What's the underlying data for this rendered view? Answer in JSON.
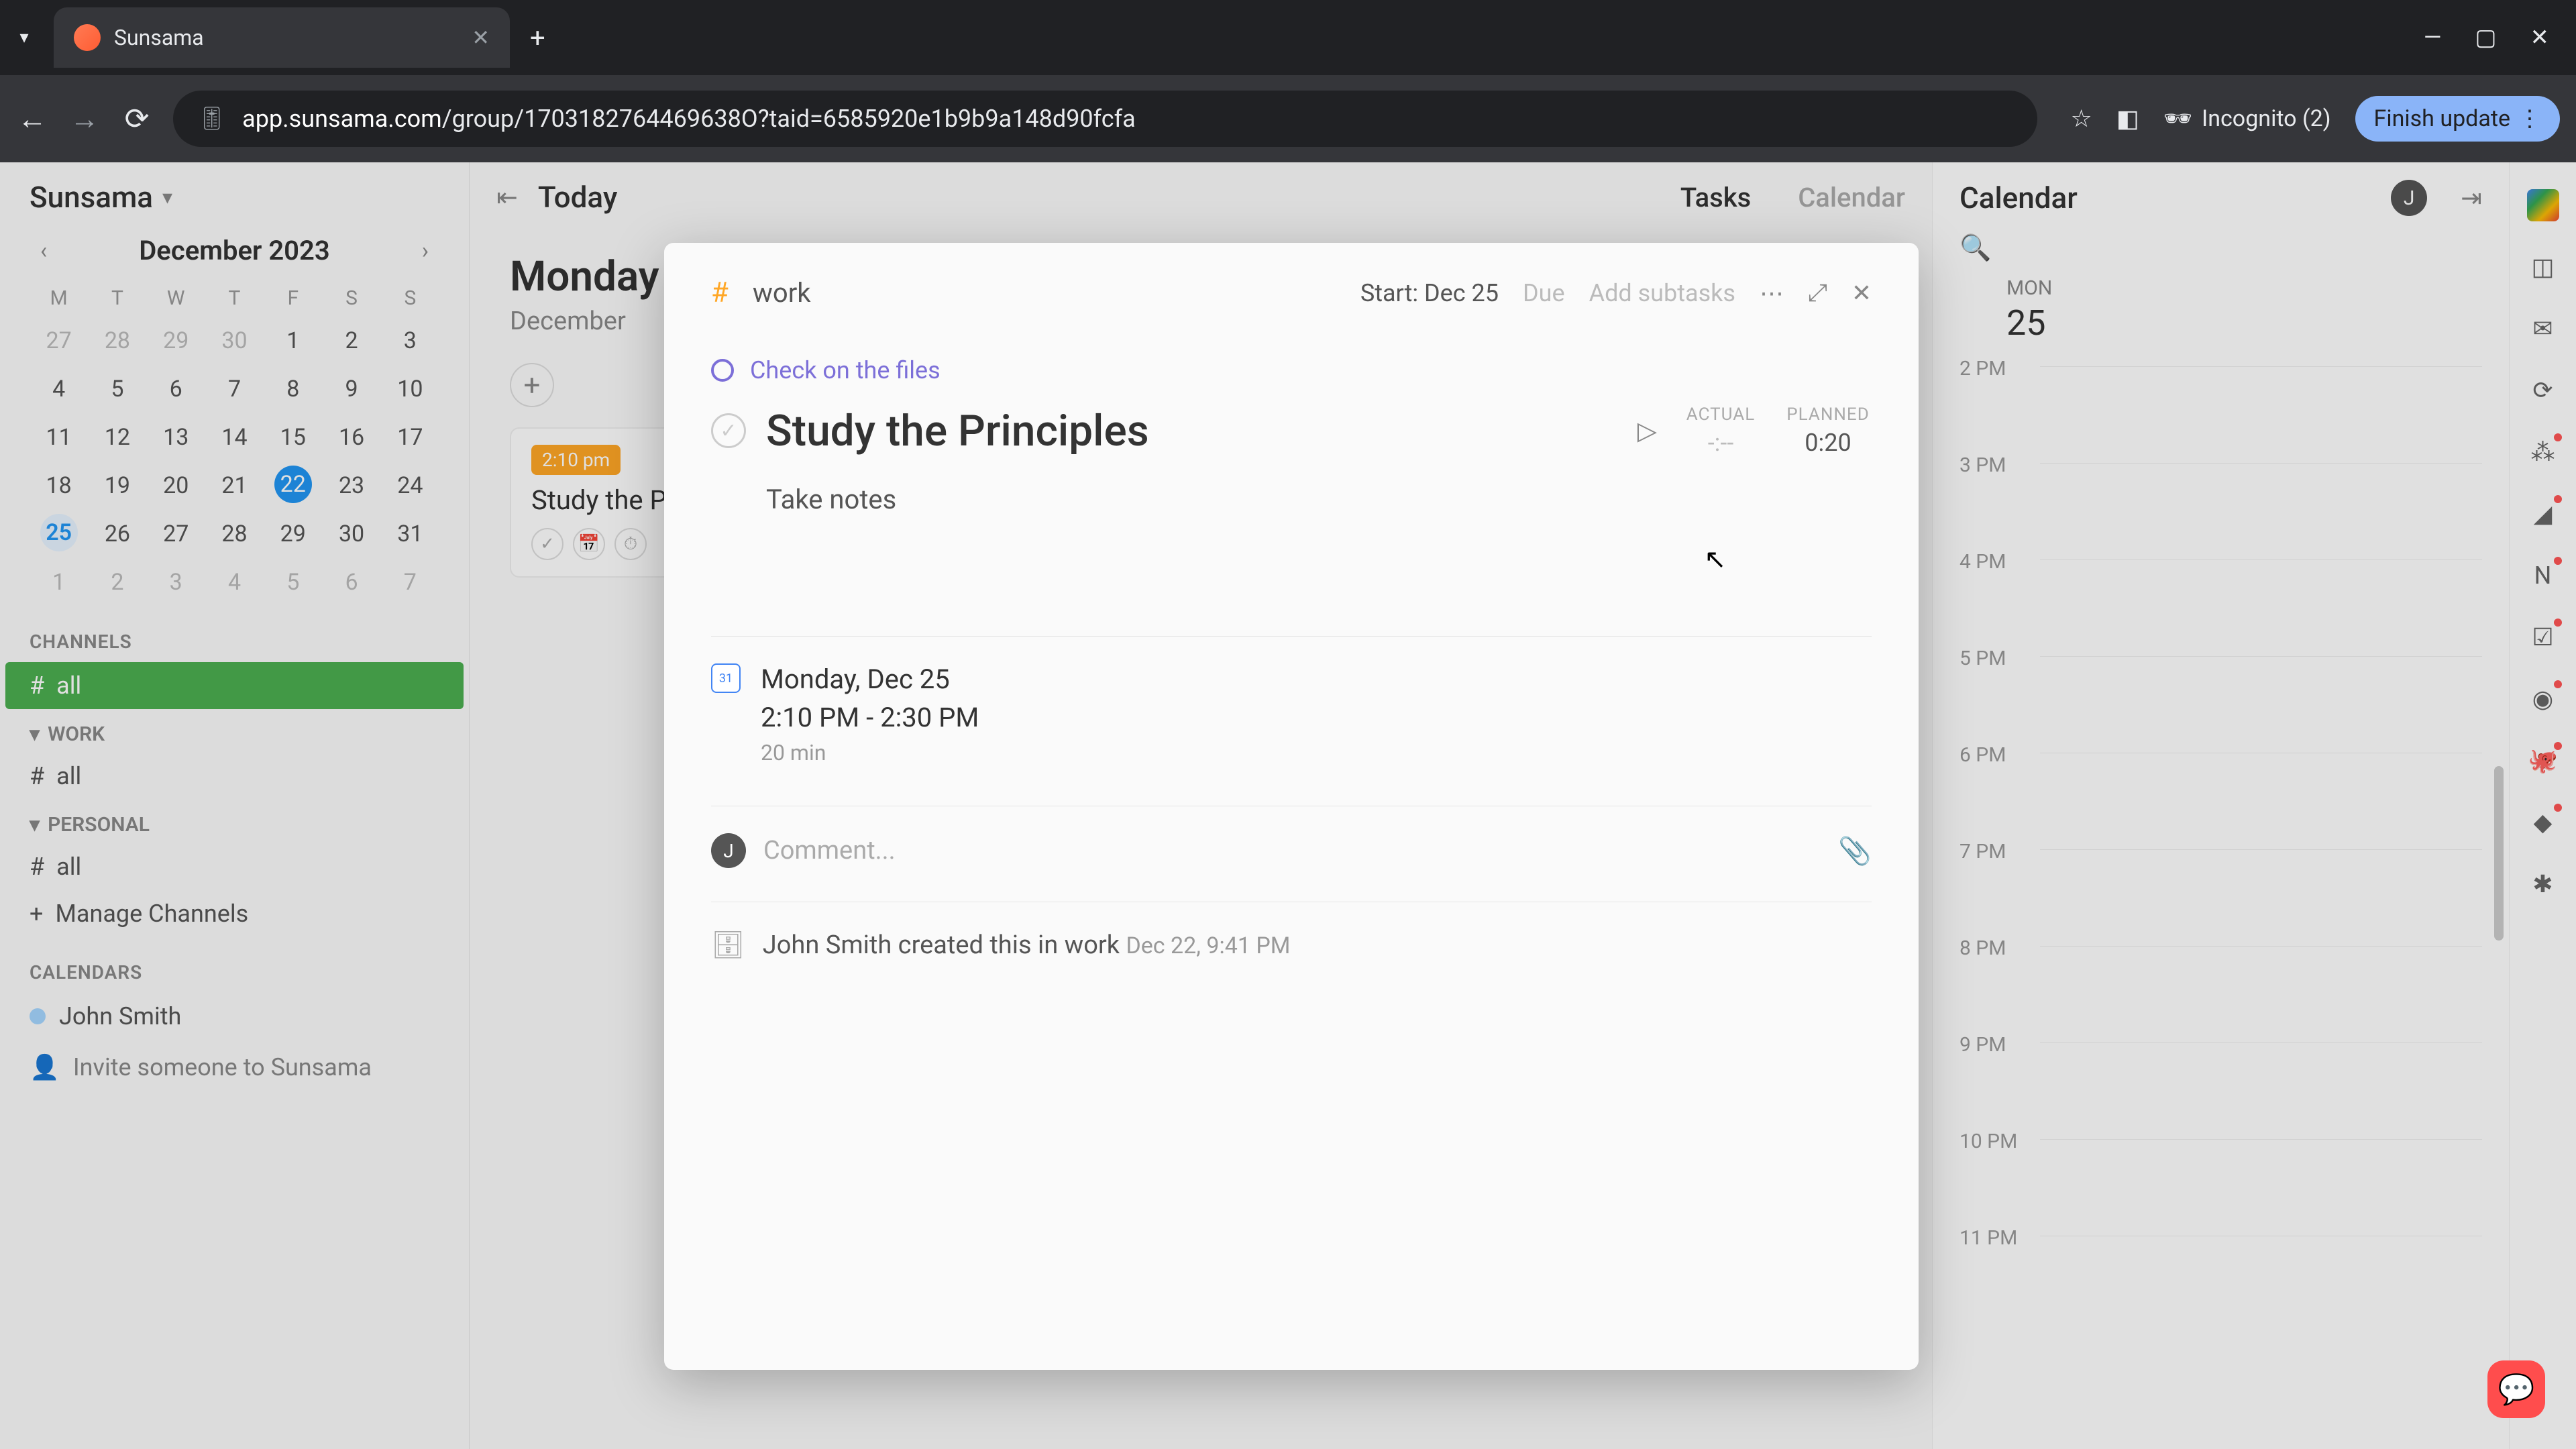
{
  "browser": {
    "tab_title": "Sunsama",
    "url_prefix": "app.sunsama.com",
    "url_path": "/group/1703182764469638O?taid=6585920e1b9b9a148d90fcfa",
    "incognito": "Incognito (2)",
    "finish_update": "Finish update"
  },
  "sidebar": {
    "workspace": "Sunsama",
    "month": "December 2023",
    "dow": [
      "M",
      "T",
      "W",
      "T",
      "F",
      "S",
      "S"
    ],
    "weeks": [
      [
        "27",
        "28",
        "29",
        "30",
        "1",
        "2",
        "3"
      ],
      [
        "4",
        "5",
        "6",
        "7",
        "8",
        "9",
        "10"
      ],
      [
        "11",
        "12",
        "13",
        "14",
        "15",
        "16",
        "17"
      ],
      [
        "18",
        "19",
        "20",
        "21",
        "22",
        "23",
        "24"
      ],
      [
        "25",
        "26",
        "27",
        "28",
        "29",
        "30",
        "31"
      ],
      [
        "1",
        "2",
        "3",
        "4",
        "5",
        "6",
        "7"
      ]
    ],
    "channels_label": "CHANNELS",
    "ch_all": "all",
    "work_label": "WORK",
    "work_all": "all",
    "personal_label": "PERSONAL",
    "personal_all": "all",
    "manage": "Manage Channels",
    "calendars_label": "CALENDARS",
    "user": "John Smith",
    "invite": "Invite someone to Sunsama"
  },
  "main": {
    "today": "Today",
    "tasks_tab": "Tasks",
    "calendar_tab": "Calendar",
    "day_heading": "Monday",
    "day_sub": "December",
    "task_tag": "2:10 pm",
    "task_title": "Study the P"
  },
  "calpanel": {
    "title": "Calendar",
    "avatar": "J",
    "day_label": "MON",
    "day_num": "25",
    "times": [
      "2 PM",
      "3 PM",
      "4 PM",
      "5 PM",
      "6 PM",
      "7 PM",
      "8 PM",
      "9 PM",
      "10 PM",
      "11 PM"
    ]
  },
  "modal": {
    "channel": "work",
    "start": "Start: Dec 25",
    "due": "Due",
    "subtasks": "Add subtasks",
    "objective": "Check on the files",
    "title": "Study the Principles",
    "actual_label": "ACTUAL",
    "actual_val": "-:--",
    "planned_label": "PLANNED",
    "planned_val": "0:20",
    "notes": "Take notes",
    "sched_date": "Monday, Dec 25",
    "sched_time": "2:10 PM - 2:30 PM",
    "sched_dur": "20 min",
    "comment_avatar": "J",
    "comment_placeholder": "Comment...",
    "history": "John Smith created this in work",
    "history_date": "Dec 22, 9:41 PM"
  }
}
